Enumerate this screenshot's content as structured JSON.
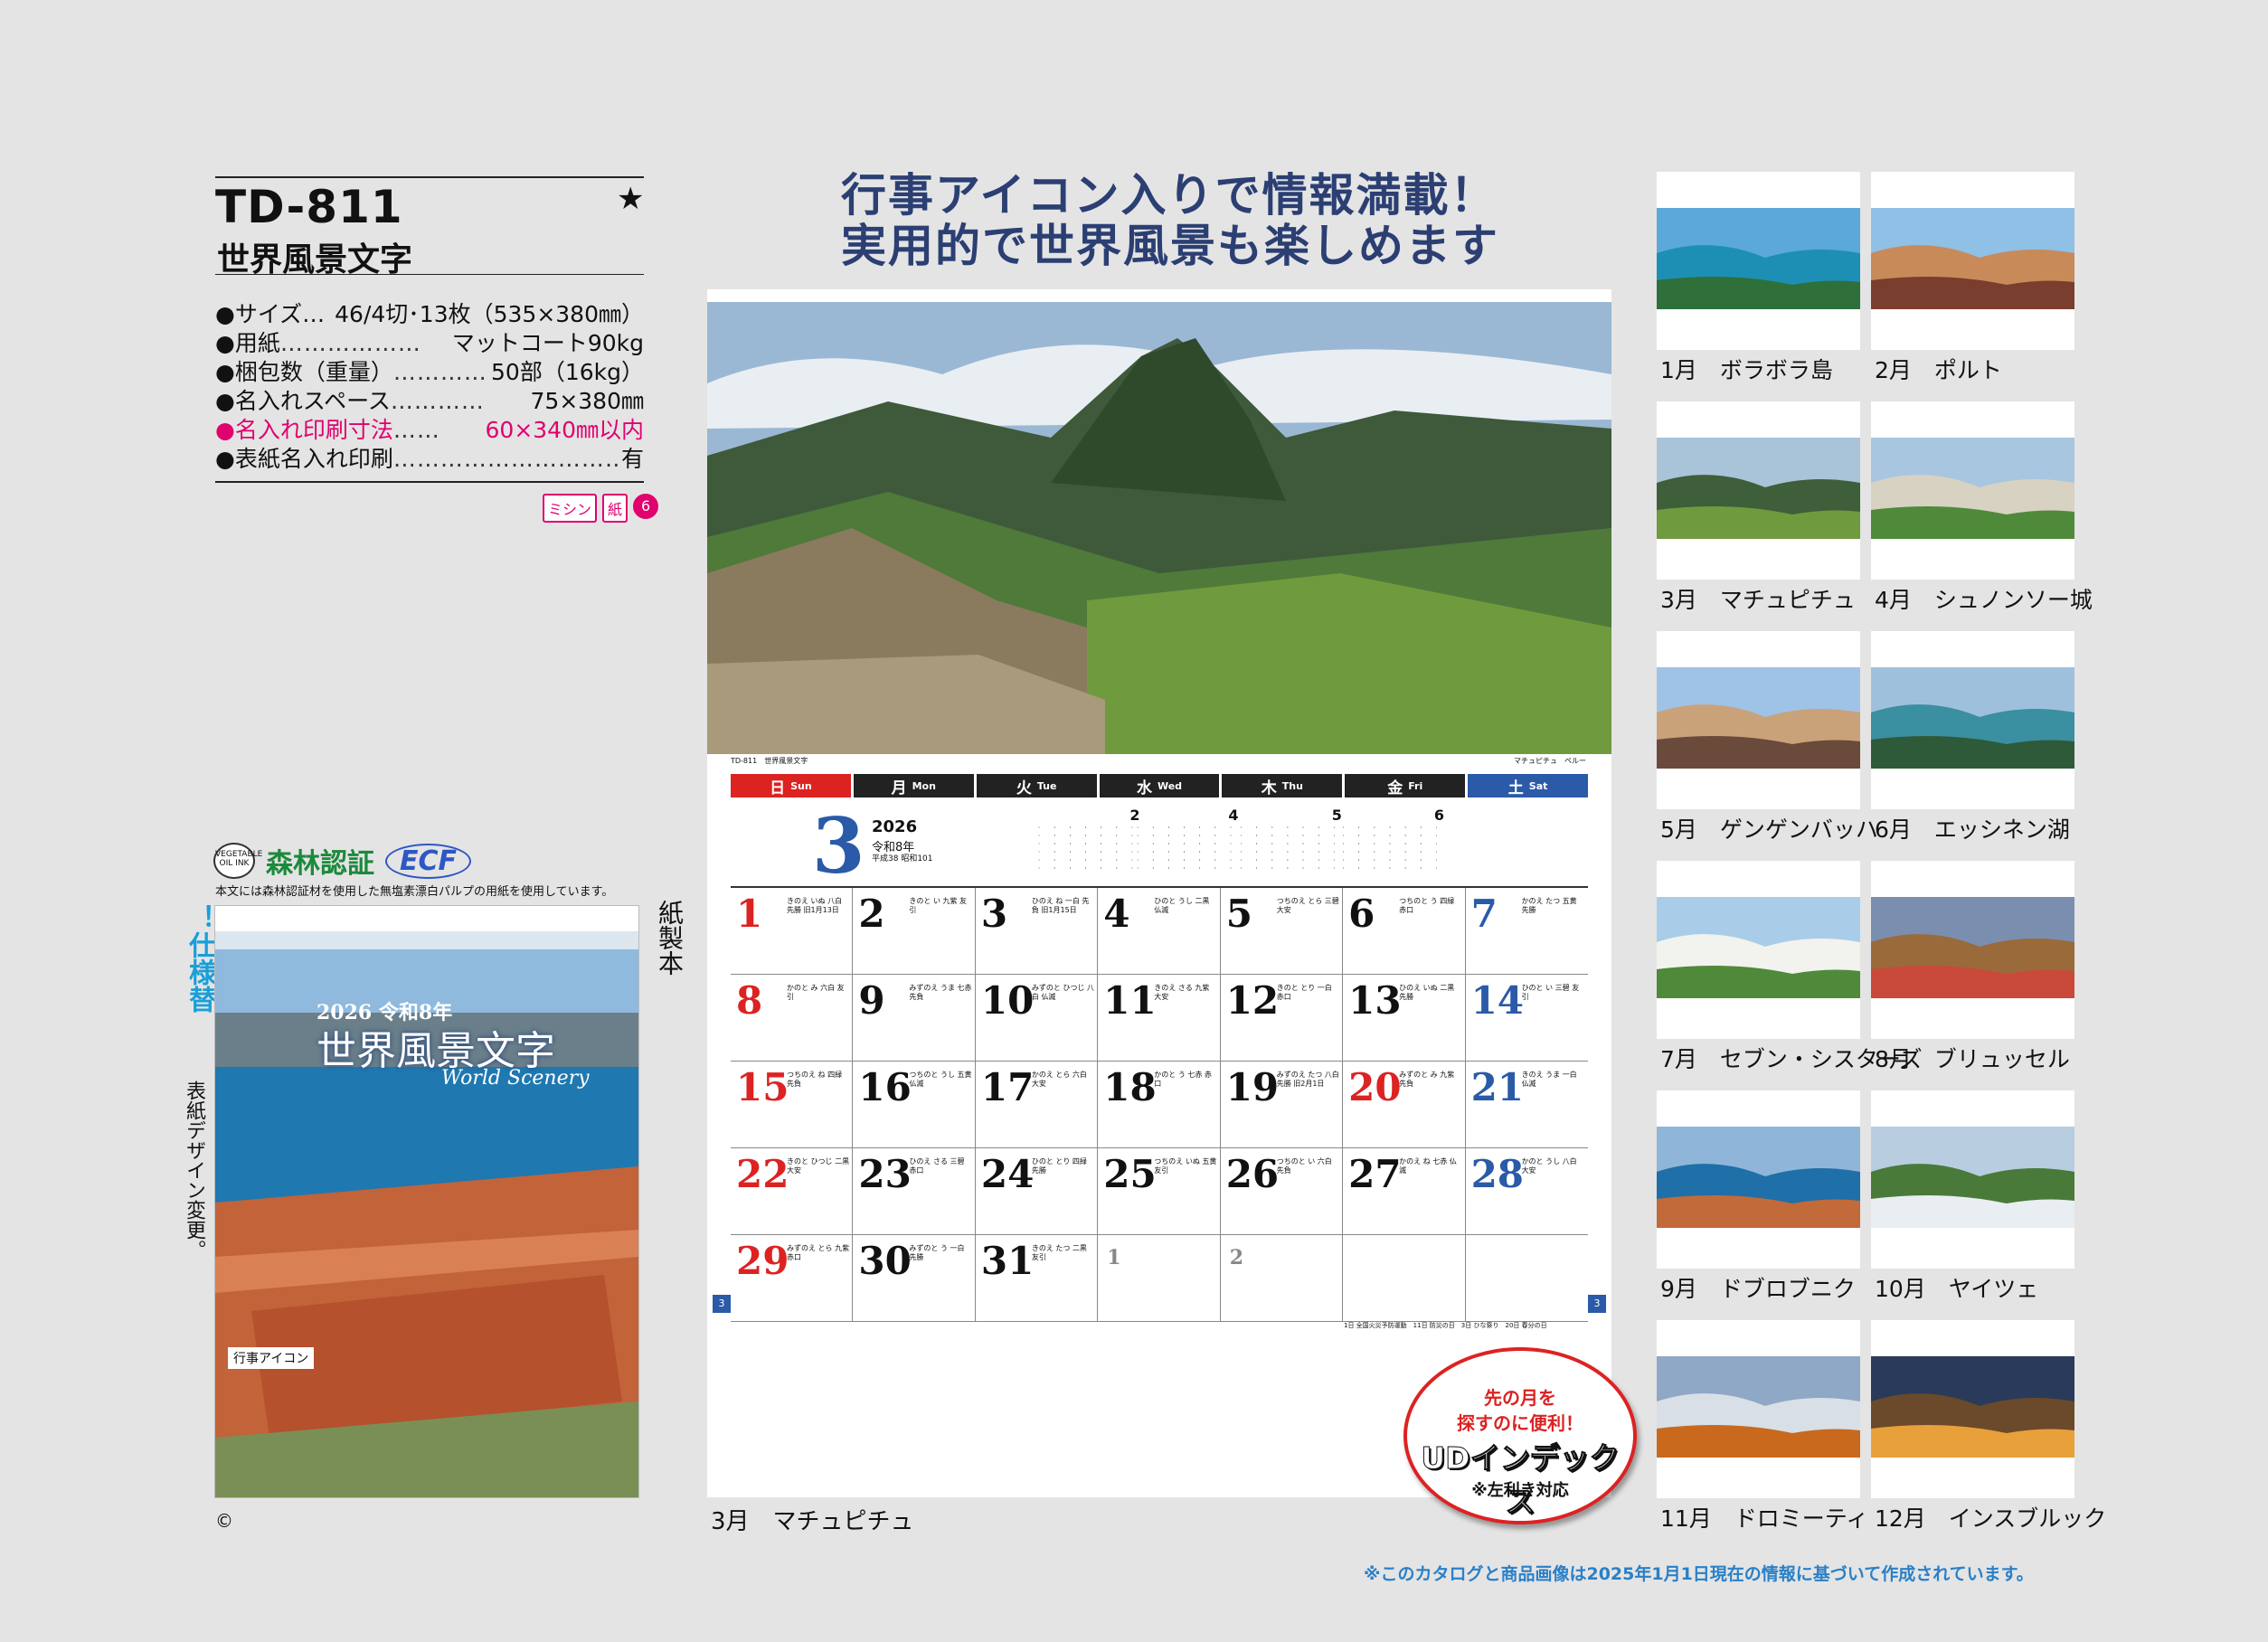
{
  "product": {
    "code": "TD-811",
    "name": "世界風景文字",
    "star": "★",
    "specs": [
      {
        "label": "●サイズ…",
        "dots": "",
        "value": "46/4切･13枚（535×380㎜）",
        "highlight": false
      },
      {
        "label": "●用紙",
        "dots": "………………",
        "value": "マットコート90kg",
        "highlight": false
      },
      {
        "label": "●梱包数（重量）",
        "dots": "…………",
        "value": "50部（16kg）",
        "highlight": false
      },
      {
        "label": "●名入れスペース",
        "dots": "…………",
        "value": "75×380㎜",
        "highlight": false
      },
      {
        "label": "●名入れ印刷寸法",
        "dots": "……",
        "value": "60×340㎜以内",
        "highlight": true
      },
      {
        "label": "●表紙名入れ印刷",
        "dots": "…………………………",
        "value": "有",
        "highlight": false
      }
    ],
    "badges": [
      "ミシン",
      "紙",
      "6"
    ]
  },
  "certification": {
    "veg_ink": "VEGETABLE OIL INK",
    "forest": "森林認証",
    "ecf": "ECF",
    "note": "本文には森林認証材を使用した無塩素漂白パルプの用紙を使用しています。"
  },
  "cover": {
    "year": "2026 令和8年",
    "title": "世界風景文字",
    "subtitle": "World Scenery",
    "icons_label": "行事アイコン",
    "binding": "紙製本",
    "spec_change": "！仕様替",
    "cover_change": "表紙デザイン変更。",
    "copyright": "©"
  },
  "headline": {
    "line1": "行事アイコン入りで情報満載！",
    "line2": "実用的で世界風景も楽しめます"
  },
  "calendar": {
    "photo_code": "TD-811　世界風景文字",
    "photo_caption": "マチュピチュ　ペルー",
    "weekdays": [
      {
        "jp": "日",
        "en": "Sun"
      },
      {
        "jp": "月",
        "en": "Mon"
      },
      {
        "jp": "火",
        "en": "Tue"
      },
      {
        "jp": "水",
        "en": "Wed"
      },
      {
        "jp": "木",
        "en": "Thu"
      },
      {
        "jp": "金",
        "en": "Fri"
      },
      {
        "jp": "土",
        "en": "Sat"
      }
    ],
    "month": "3",
    "year": "2026",
    "reiwa": "令和8年",
    "heisei": "平成38 昭和101",
    "mini_months": [
      "2",
      "4",
      "5",
      "6"
    ],
    "days": [
      {
        "d": "1",
        "note": "きのえ いぬ 八白 先勝 旧1月13日"
      },
      {
        "d": "2",
        "note": "きのと い 九紫 友引"
      },
      {
        "d": "3",
        "note": "ひのえ ね 一白 先負 旧1月15日"
      },
      {
        "d": "4",
        "note": "ひのと うし 二黒 仏滅"
      },
      {
        "d": "5",
        "note": "つちのえ とら 三碧 大安"
      },
      {
        "d": "6",
        "note": "つちのと う 四緑 赤口"
      },
      {
        "d": "7",
        "note": "かのえ たつ 五黄 先勝"
      },
      {
        "d": "8",
        "note": "かのと み 六白 友引"
      },
      {
        "d": "9",
        "note": "みずのえ うま 七赤 先負"
      },
      {
        "d": "10",
        "note": "みずのと ひつじ 八白 仏滅"
      },
      {
        "d": "11",
        "note": "きのえ さる 九紫 大安"
      },
      {
        "d": "12",
        "note": "きのと とり 一白 赤口"
      },
      {
        "d": "13",
        "note": "ひのえ いぬ 二黒 先勝"
      },
      {
        "d": "14",
        "note": "ひのと い 三碧 友引"
      },
      {
        "d": "15",
        "note": "つちのえ ね 四緑 先負"
      },
      {
        "d": "16",
        "note": "つちのと うし 五黄 仏滅"
      },
      {
        "d": "17",
        "note": "かのえ とら 六白 大安"
      },
      {
        "d": "18",
        "note": "かのと う 七赤 赤口"
      },
      {
        "d": "19",
        "note": "みずのえ たつ 八白 先勝 旧2月1日"
      },
      {
        "d": "20",
        "note": "みずのと み 九紫 先負"
      },
      {
        "d": "21",
        "note": "きのえ うま 一白 仏滅"
      },
      {
        "d": "22",
        "note": "きのと ひつじ 二黒 大安"
      },
      {
        "d": "23",
        "note": "ひのえ さる 三碧 赤口"
      },
      {
        "d": "24",
        "note": "ひのと とり 四緑 先勝"
      },
      {
        "d": "25",
        "note": "つちのえ いぬ 五黄 友引"
      },
      {
        "d": "26",
        "note": "つちのと い 六白 先負"
      },
      {
        "d": "27",
        "note": "かのえ ね 七赤 仏滅"
      },
      {
        "d": "28",
        "note": "かのと うし 八白 大安"
      },
      {
        "d": "29",
        "note": "みずのえ とら 九紫 赤口"
      },
      {
        "d": "30",
        "note": "みずのと う 一白 先勝"
      },
      {
        "d": "31",
        "note": "きのえ たつ 二黒 友引"
      },
      {
        "d": "1",
        "note": ""
      },
      {
        "d": "2",
        "note": ""
      }
    ],
    "notes": "1日 全国火災予防運動　11日 防災の日　3日 ひな祭り　20日 春分の日",
    "page_num": "3"
  },
  "main_caption": "3月　マチュピチュ",
  "ud_badge": {
    "line1": "先の月を",
    "line2": "探すのに便利！",
    "title": "UDインデックス",
    "note": "※左利き対応"
  },
  "thumbnails": [
    {
      "caption": "1月　ボラボラ島"
    },
    {
      "caption": "2月　ポルト"
    },
    {
      "caption": "3月　マチュピチュ"
    },
    {
      "caption": "4月　シュノンソー城"
    },
    {
      "caption": "5月　ゲンゲンバッハ"
    },
    {
      "caption": "6月　エッシネン湖"
    },
    {
      "caption": "7月　セブン・シスターズ"
    },
    {
      "caption": "8月　ブリュッセル"
    },
    {
      "caption": "9月　ドブロブニク"
    },
    {
      "caption": "10月　ヤイツェ"
    },
    {
      "caption": "11月　ドロミーティ"
    },
    {
      "caption": "12月　インスブルック"
    }
  ],
  "footnote": "※このカタログと商品画像は2025年1月1日現在の情報に基づいて作成されています。",
  "colors": {
    "accent_blue": "#2b3f73",
    "sunday_red": "#d22",
    "saturday_blue": "#2a5aa8",
    "pink": "#e0006e"
  }
}
